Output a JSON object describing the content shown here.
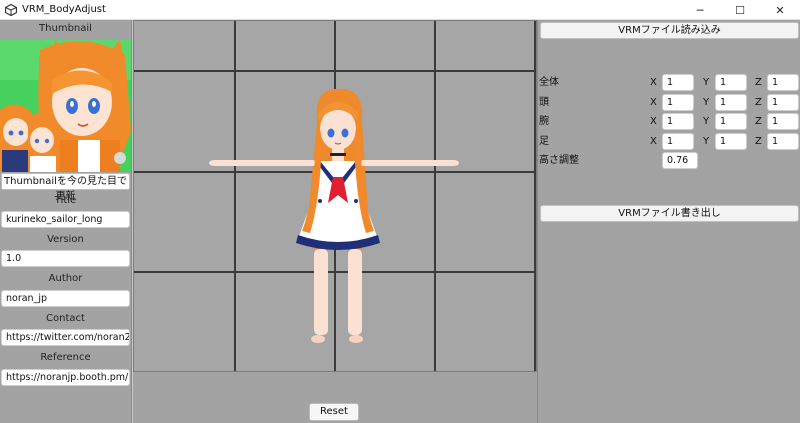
{
  "window": {
    "title": "VRM_BodyAdjust",
    "minimize": "─",
    "maximize": "☐",
    "close": "✕"
  },
  "left": {
    "thumbnail_label": "Thumbnail",
    "thumbnail_button": "Thumbnailを今の見た目で更新",
    "title_label": "Title",
    "title_value": "kurineko_sailor_long",
    "version_label": "Version",
    "version_value": "1.0",
    "author_label": "Author",
    "author_value": "noran_jp",
    "contact_label": "Contact",
    "contact_value": "https://twitter.com/noran256",
    "reference_label": "Reference",
    "reference_value": "https://noranjp.booth.pm/"
  },
  "viewport": {
    "reset_label": "Reset"
  },
  "right": {
    "load_button": "VRMファイル読み込み",
    "export_button": "VRMファイル書き出し",
    "axis_x": "X",
    "axis_y": "Y",
    "axis_z": "Z",
    "rows": [
      {
        "label": "全体",
        "x": "1",
        "y": "1",
        "z": "1"
      },
      {
        "label": "頭",
        "x": "1",
        "y": "1",
        "z": "1"
      },
      {
        "label": "腕",
        "x": "1",
        "y": "1",
        "z": "1"
      },
      {
        "label": "足",
        "x": "1",
        "y": "1",
        "z": "1"
      }
    ],
    "height_label": "高さ調整",
    "height_value": "0.76"
  }
}
